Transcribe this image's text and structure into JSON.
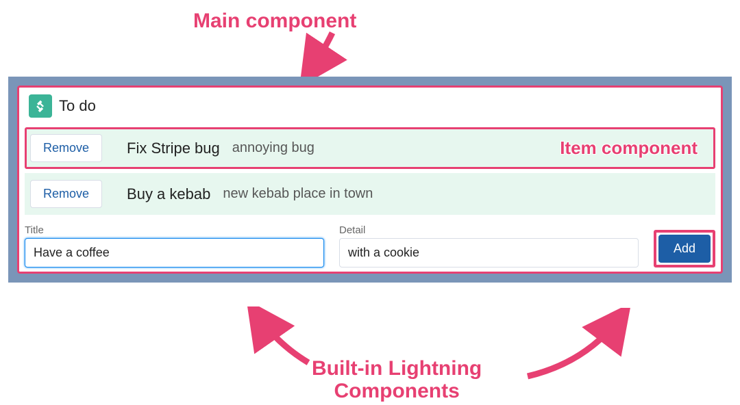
{
  "annotations": {
    "main": "Main component",
    "item": "Item component",
    "builtin": "Built-in Lightning\nComponents"
  },
  "card": {
    "title": "To do",
    "icon_name": "handshake-icon"
  },
  "items": [
    {
      "title": "Fix Stripe bug",
      "detail": "annoying bug",
      "highlighted": true,
      "show_anno": true
    },
    {
      "title": "Buy a kebab",
      "detail": "new kebab place in town",
      "highlighted": false,
      "show_anno": false
    }
  ],
  "remove_label": "Remove",
  "form": {
    "title_label": "Title",
    "title_value": "Have a coffee",
    "detail_label": "Detail",
    "detail_value": "with a cookie",
    "add_label": "Add"
  },
  "colors": {
    "pink": "#e74072",
    "blue": "#1d5ea6",
    "teal": "#3bb497",
    "mintbg": "#e7f7ef",
    "framebg": "#7a95b8"
  }
}
